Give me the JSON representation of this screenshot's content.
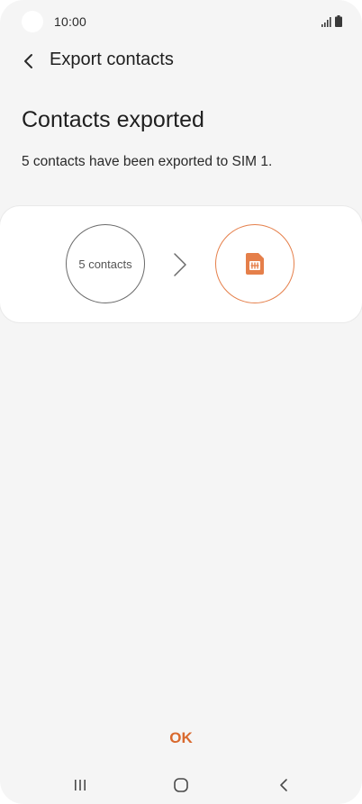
{
  "status_bar": {
    "time": "10:00",
    "icons": [
      "signal-icon",
      "battery-icon"
    ]
  },
  "header": {
    "title": "Export contacts",
    "back_icon": "chevron-left-icon"
  },
  "content": {
    "title": "Contacts exported",
    "description": "5 contacts have been exported to SIM 1."
  },
  "export_card": {
    "source_label": "5 contacts",
    "arrow_icon": "chevron-right-icon",
    "target_icon": "sim-card-icon"
  },
  "actions": {
    "ok_label": "OK"
  },
  "navigation": {
    "icons": [
      "recents-icon",
      "home-icon",
      "back-icon"
    ]
  },
  "colors": {
    "accent": "#e57f4a",
    "ok_text": "#d9692e",
    "background": "#f5f5f5",
    "card": "#ffffff"
  }
}
